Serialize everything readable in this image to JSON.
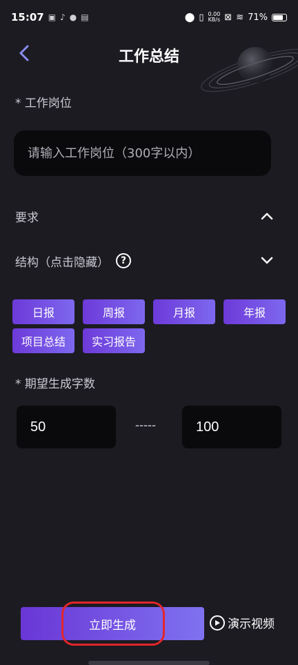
{
  "status_bar": {
    "time": "15:07",
    "net_speed_value": "0.00",
    "net_speed_unit": "KB/s",
    "battery": "71%"
  },
  "header": {
    "title": "工作总结"
  },
  "form": {
    "position_label": "* 工作岗位",
    "position_placeholder": "请输入工作岗位（300字以内）",
    "requirements_label": "要求",
    "structure_label": "结构（点击隐藏）",
    "help_glyph": "?",
    "chips": [
      "日报",
      "周报",
      "月报",
      "年报",
      "项目总结",
      "实习报告"
    ],
    "word_count_label": "* 期望生成字数",
    "min_words": "50",
    "range_separator": "-----",
    "max_words": "100"
  },
  "footer": {
    "generate_label": "立即生成",
    "demo_label": "演示视频"
  },
  "colors": {
    "background": "#1c1b21",
    "input_bg": "#0a0a0d",
    "accent_start": "#6a36d6",
    "accent_end": "#7f72f0",
    "highlight_ring": "#e2262b"
  },
  "icons": {
    "back": "chevron-left-icon",
    "requirements_toggle": "chevron-up-icon",
    "structure_toggle": "chevron-down-icon",
    "help": "question-circle-icon",
    "demo": "play-circle-icon",
    "decoration": "planet-icon"
  }
}
